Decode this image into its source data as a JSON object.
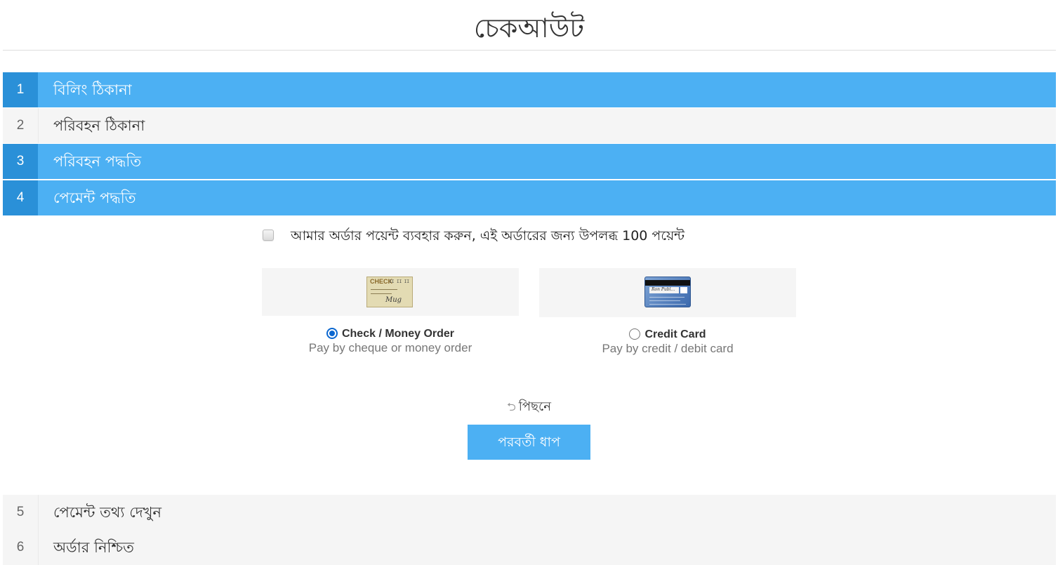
{
  "page": {
    "title": "চেকআউট"
  },
  "steps": [
    {
      "number": "1",
      "label": "বিলিং ঠিকানা"
    },
    {
      "number": "2",
      "label": "পরিবহন ঠিকানা"
    },
    {
      "number": "3",
      "label": "পরিবহন পদ্ধতি"
    },
    {
      "number": "4",
      "label": "পেমেন্ট পদ্ধতি"
    },
    {
      "number": "5",
      "label": "পেমেন্ট তথ্য দেখুন"
    },
    {
      "number": "6",
      "label": "অর্ডার নিশ্চিত"
    }
  ],
  "reward_points": {
    "label": "আমার অর্ডার পয়েন্ট ব্যবহার করুন, এই অর্ডারের জন্য উপলব্ধ 100 পয়েন্ট",
    "checked": false
  },
  "payment_methods": [
    {
      "name": "Check / Money Order",
      "description": "Pay by cheque or money order",
      "selected": true,
      "image": {
        "icon": "check-icon",
        "text": "CHECK",
        "code": "II II II",
        "signature": "Mug"
      }
    },
    {
      "name": "Credit Card",
      "description": "Pay by credit / debit card",
      "selected": false,
      "image": {
        "icon": "credit-card-icon",
        "signature": "Ron Publ...",
        "cvv": "▪▪▪"
      }
    }
  ],
  "nav": {
    "back_icon": "⮌",
    "back_label": "পিছনে",
    "next_label": "পরবর্তী ধাপ"
  },
  "colors": {
    "accent": "#4cb0f3",
    "accent_dark": "#2a90d8",
    "inactive_bg": "#f5f5f5"
  }
}
